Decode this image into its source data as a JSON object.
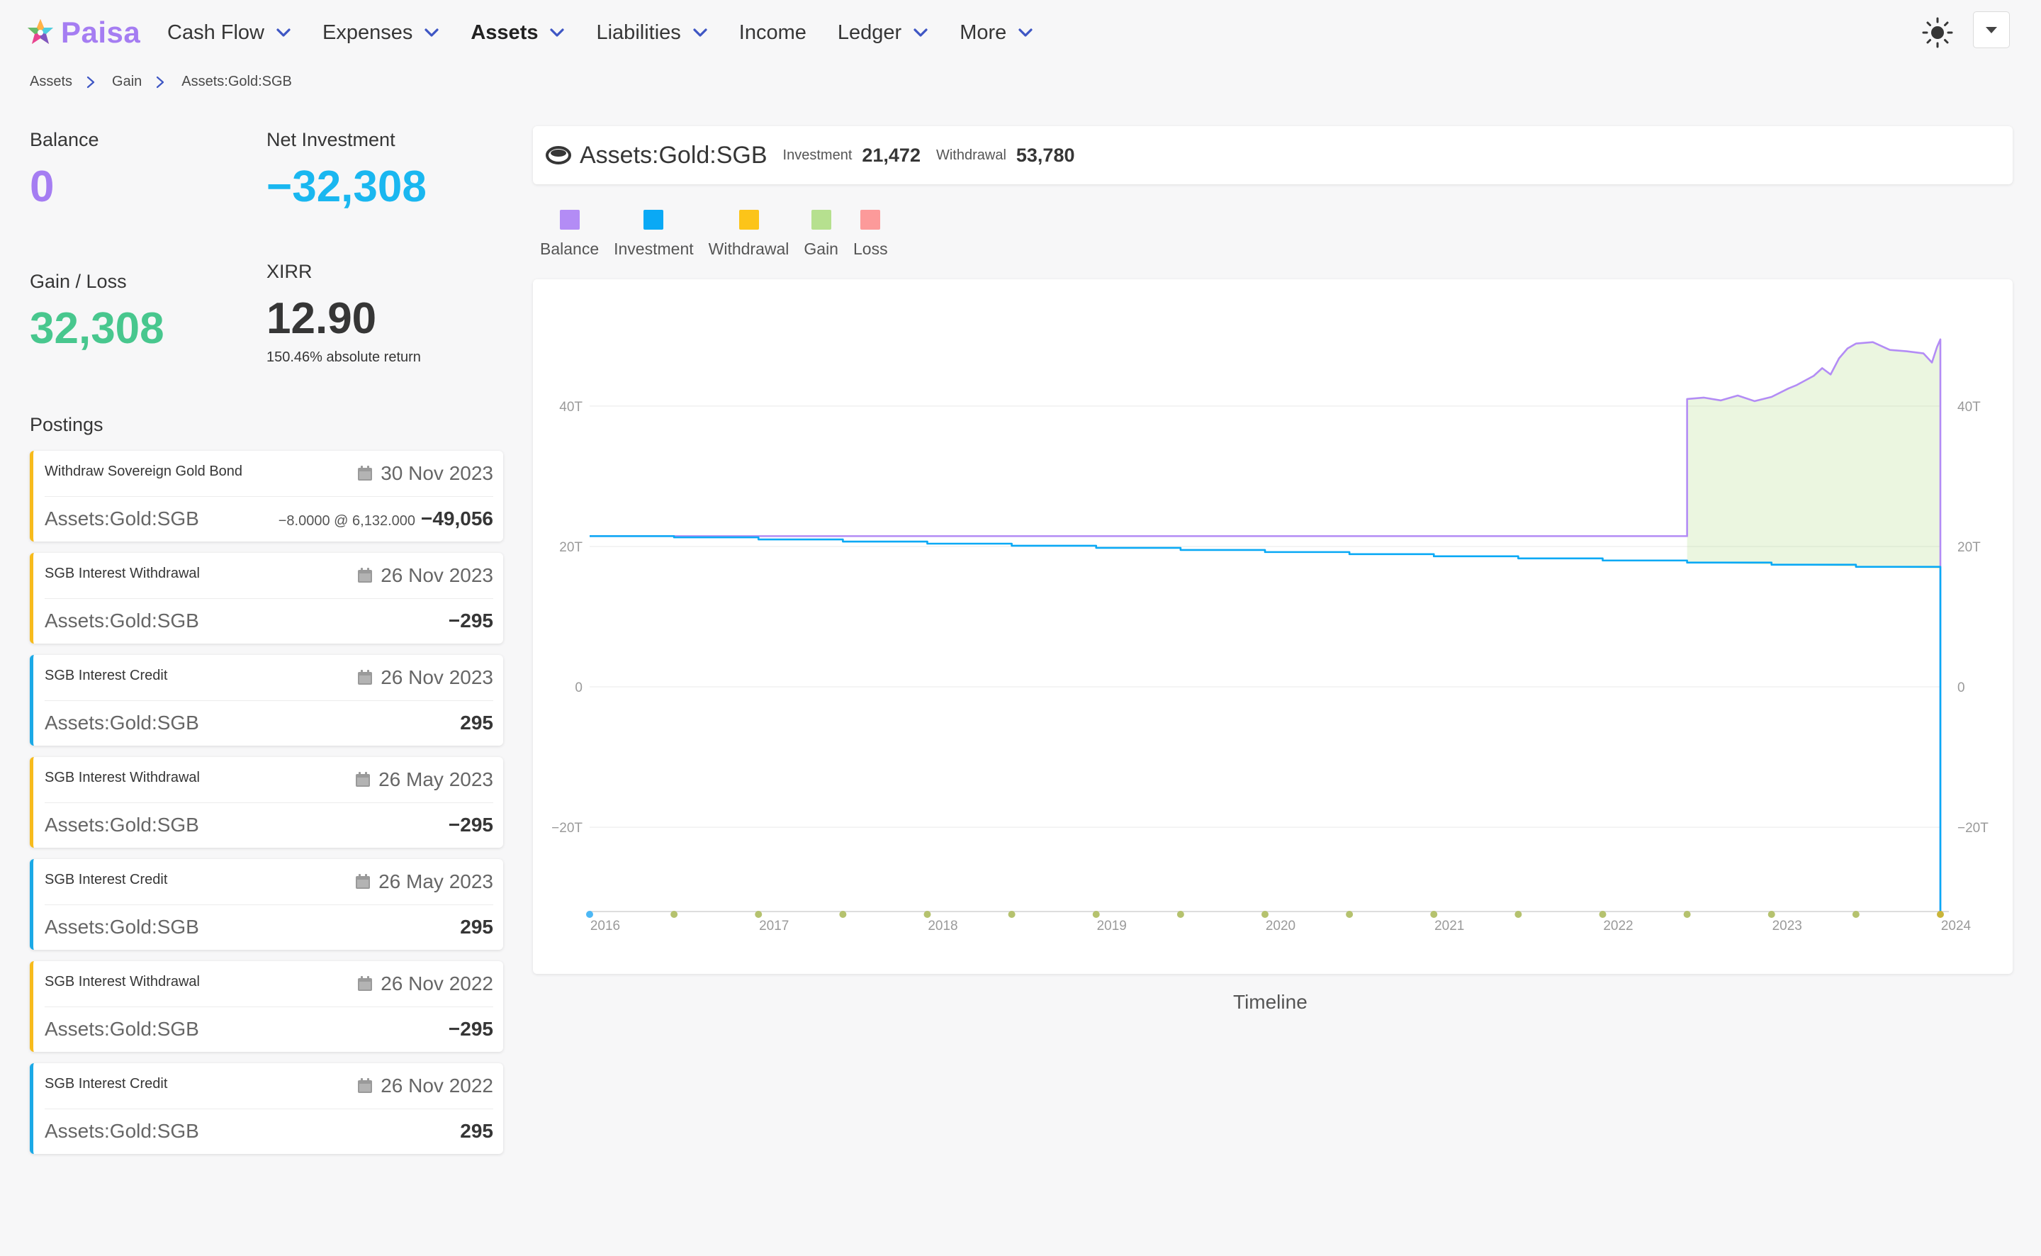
{
  "nav": {
    "brand": "Paisa",
    "items": [
      {
        "label": "Cash Flow",
        "has_menu": true,
        "active": false
      },
      {
        "label": "Expenses",
        "has_menu": true,
        "active": false
      },
      {
        "label": "Assets",
        "has_menu": true,
        "active": true
      },
      {
        "label": "Liabilities",
        "has_menu": true,
        "active": false
      },
      {
        "label": "Income",
        "has_menu": false,
        "active": false
      },
      {
        "label": "Ledger",
        "has_menu": true,
        "active": false
      },
      {
        "label": "More",
        "has_menu": true,
        "active": false
      }
    ]
  },
  "breadcrumb": [
    "Assets",
    "Gain",
    "Assets:Gold:SGB"
  ],
  "stats": {
    "balance": {
      "label": "Balance",
      "value": "0",
      "color": "#a57df2"
    },
    "net_investment": {
      "label": "Net Investment",
      "value": "−32,308",
      "color": "#1ab7f0"
    },
    "gain_loss": {
      "label": "Gain / Loss",
      "value": "32,308",
      "color": "#48c78e"
    },
    "xirr": {
      "label": "XIRR",
      "value": "12.90",
      "sub": "150.46% absolute return",
      "color": "#363636"
    }
  },
  "postings_title": "Postings",
  "postings": [
    {
      "desc": "Withdraw Sovereign Gold Bond",
      "date": "30 Nov 2023",
      "account": "Assets:Gold:SGB",
      "detail": "−8.0000 @ 6,132.000",
      "amount": "−49,056",
      "kind": "withdrawal"
    },
    {
      "desc": "SGB Interest Withdrawal",
      "date": "26 Nov 2023",
      "account": "Assets:Gold:SGB",
      "detail": "",
      "amount": "−295",
      "kind": "withdrawal"
    },
    {
      "desc": "SGB Interest Credit",
      "date": "26 Nov 2023",
      "account": "Assets:Gold:SGB",
      "detail": "",
      "amount": "295",
      "kind": "credit"
    },
    {
      "desc": "SGB Interest Withdrawal",
      "date": "26 May 2023",
      "account": "Assets:Gold:SGB",
      "detail": "",
      "amount": "−295",
      "kind": "withdrawal"
    },
    {
      "desc": "SGB Interest Credit",
      "date": "26 May 2023",
      "account": "Assets:Gold:SGB",
      "detail": "",
      "amount": "295",
      "kind": "credit"
    },
    {
      "desc": "SGB Interest Withdrawal",
      "date": "26 Nov 2022",
      "account": "Assets:Gold:SGB",
      "detail": "",
      "amount": "−295",
      "kind": "withdrawal"
    },
    {
      "desc": "SGB Interest Credit",
      "date": "26 Nov 2022",
      "account": "Assets:Gold:SGB",
      "detail": "",
      "amount": "295",
      "kind": "credit"
    }
  ],
  "header": {
    "account": "Assets:Gold:SGB",
    "investment_label": "Investment",
    "investment_value": "21,472",
    "withdrawal_label": "Withdrawal",
    "withdrawal_value": "53,780"
  },
  "legend": [
    {
      "label": "Balance",
      "color": "#b38cf5"
    },
    {
      "label": "Investment",
      "color": "#0aa9f5"
    },
    {
      "label": "Withdrawal",
      "color": "#fcc419"
    },
    {
      "label": "Gain",
      "color": "#b6e08f"
    },
    {
      "label": "Loss",
      "color": "#fc9a9a"
    }
  ],
  "timeline_label": "Timeline",
  "chart_data": {
    "type": "line",
    "x_axis": {
      "min": 2016,
      "max": 2024,
      "ticks": [
        "2016",
        "2017",
        "2018",
        "2019",
        "2020",
        "2021",
        "2022",
        "2023",
        "2024"
      ]
    },
    "y_axis": {
      "min": -32000,
      "max": 52000,
      "tick_values": [
        -20000,
        0,
        20000,
        40000
      ],
      "tick_labels": [
        "−20T",
        "0",
        "20T",
        "40T"
      ]
    },
    "grid": true,
    "series": [
      {
        "name": "Balance",
        "color": "#b38cf5",
        "points": [
          [
            2016.0,
            21472
          ],
          [
            2022.5,
            21472
          ],
          [
            2022.5,
            41000
          ],
          [
            2022.6,
            41200
          ],
          [
            2022.7,
            40800
          ],
          [
            2022.8,
            41500
          ],
          [
            2022.9,
            40700
          ],
          [
            2023.0,
            41300
          ],
          [
            2023.1,
            42500
          ],
          [
            2023.15,
            43000
          ],
          [
            2023.25,
            44300
          ],
          [
            2023.3,
            45400
          ],
          [
            2023.35,
            44500
          ],
          [
            2023.4,
            46800
          ],
          [
            2023.45,
            48200
          ],
          [
            2023.5,
            48900
          ],
          [
            2023.6,
            49100
          ],
          [
            2023.7,
            48000
          ],
          [
            2023.8,
            47800
          ],
          [
            2023.9,
            47500
          ],
          [
            2023.95,
            46200
          ],
          [
            2023.98,
            48400
          ],
          [
            2024.0,
            49500
          ],
          [
            2024.0,
            -32000
          ]
        ]
      },
      {
        "name": "Investment",
        "color": "#0aa9f5",
        "points": [
          [
            2016.0,
            21472
          ],
          [
            2016.5,
            21300
          ],
          [
            2017.0,
            21000
          ],
          [
            2017.5,
            20700
          ],
          [
            2018.0,
            20400
          ],
          [
            2018.5,
            20100
          ],
          [
            2019.0,
            19800
          ],
          [
            2019.5,
            19500
          ],
          [
            2020.0,
            19200
          ],
          [
            2020.5,
            18900
          ],
          [
            2021.0,
            18600
          ],
          [
            2021.5,
            18300
          ],
          [
            2022.0,
            18000
          ],
          [
            2022.5,
            17700
          ],
          [
            2023.0,
            17400
          ],
          [
            2023.5,
            17100
          ],
          [
            2024.0,
            16800
          ],
          [
            2024.0,
            -32000
          ]
        ]
      }
    ],
    "gain_region": {
      "color": "#b6e08f",
      "x_from": 2022.5,
      "x_to": 2024.0
    }
  }
}
